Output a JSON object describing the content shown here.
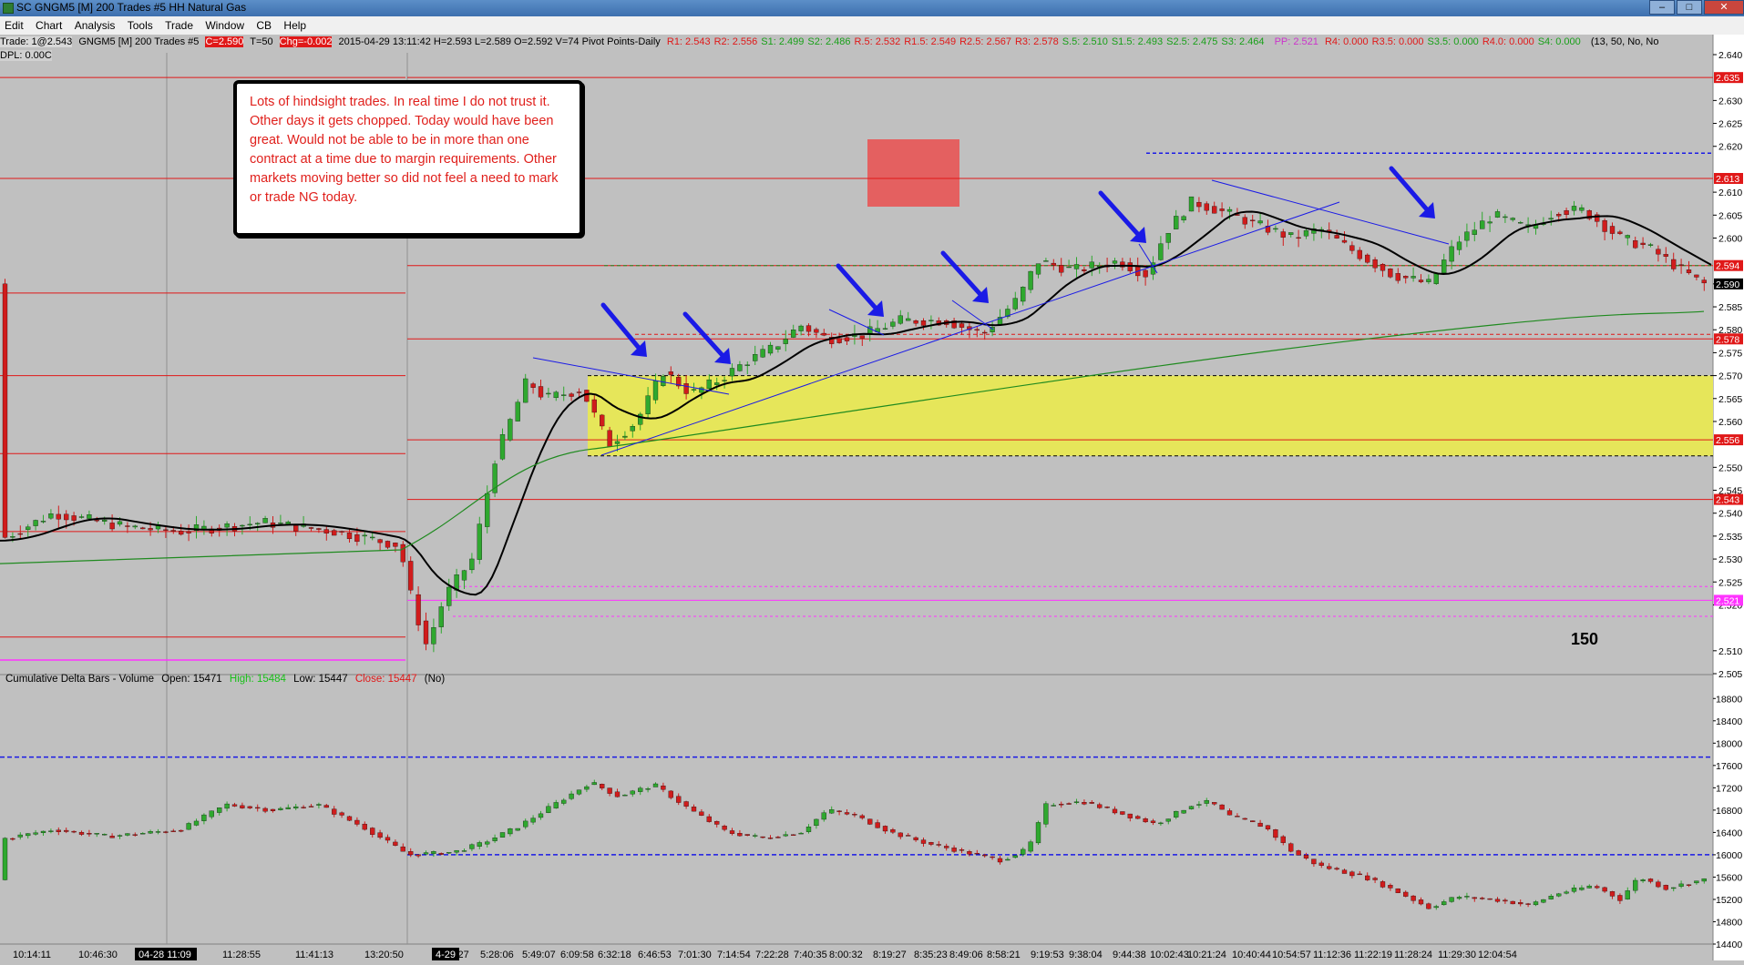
{
  "window": {
    "title": "SC GNGM5 [M]  200 Trades  #5  HH Natural Gas",
    "buttons": {
      "minimize": "–",
      "maximize": "□",
      "close": "✕"
    }
  },
  "menu": [
    "Edit",
    "Chart",
    "Analysis",
    "Tools",
    "Trade",
    "Window",
    "CB",
    "Help"
  ],
  "info": {
    "trade": "Trade: 1@2.543",
    "symbol": "GNGM5 [M]  200 Trades #5",
    "last": "C=2.590",
    "tq": "T=50",
    "chg": "Chg=-0.002",
    "ohlc": "2015-04-29 13:11:42 H=2.593 L=2.589 O=2.592 V=74 Pivot Points-Daily",
    "levels": [
      "R1: 2.543",
      "R2: 2.556",
      "S1: 2.499",
      "S2: 2.486",
      "R.5: 2.532",
      "R1.5: 2.549",
      "R2.5: 2.567",
      "R3: 2.578",
      "S.5: 2.510",
      "S1.5: 2.493",
      "S2.5: 2.475",
      "S3: 2.464"
    ],
    "pp": "PP: 2.521",
    "extra": [
      "R4: 0.000",
      "R3.5: 0.000",
      "S3.5: 0.000",
      "R4.0: 0.000",
      "S4: 0.000"
    ],
    "params": "(13, 50, No, No"
  },
  "dpl": "DPL: 0.00C",
  "note": "Lots of hindsight trades.  In real time I do not trust it.  Other days it gets chopped.  Today would have been great.  Would not be able to be in more than one contract at a time due to margin requirements.  Other markets moving better so did not feel a need to mark or trade NG today.",
  "big_label": "150",
  "lower_header": {
    "name": "Cumulative Delta Bars - Volume",
    "open": "Open: 15471",
    "high": "High: 15484",
    "low": "Low: 15447",
    "close": "Close: 15447",
    "flag": "(No)"
  },
  "colors": {
    "background": "#c0c0c0",
    "up_candle": "#2fa82f",
    "down_candle": "#d01c1c",
    "pivot_line": "#e01818",
    "arrow": "#1a1ae6",
    "zone": "#e6e65a",
    "box": "#e46060",
    "magenta": "#ff33ff"
  },
  "price_axis": {
    "min": 2.505,
    "max": 2.64,
    "ticks": [
      "2.640",
      "2.630",
      "2.625",
      "2.620",
      "2.610",
      "2.605",
      "2.600",
      "2.590",
      "2.585",
      "2.580",
      "2.575",
      "2.570",
      "2.565",
      "2.560",
      "2.550",
      "2.545",
      "2.540",
      "2.535",
      "2.530",
      "2.525",
      "2.520",
      "2.510",
      "2.505"
    ],
    "markers": [
      {
        "value": 2.635,
        "label": "2.635",
        "color": "#e01818"
      },
      {
        "value": 2.613,
        "label": "2.613",
        "color": "#e01818"
      },
      {
        "value": 2.594,
        "label": "2.594",
        "color": "#e01818"
      },
      {
        "value": 2.59,
        "label": "2.590",
        "color": "#000000"
      },
      {
        "value": 2.578,
        "label": "2.578",
        "color": "#e01818"
      },
      {
        "value": 2.556,
        "label": "2.556",
        "color": "#e01818"
      },
      {
        "value": 2.543,
        "label": "2.543",
        "color": "#e01818"
      },
      {
        "value": 2.521,
        "label": "2.521",
        "color": "#ff33ff"
      }
    ]
  },
  "delta_axis": {
    "min": 14400,
    "max": 19000,
    "ticks": [
      "18800",
      "18400",
      "18000",
      "17600",
      "17200",
      "16800",
      "16400",
      "16000",
      "15600",
      "15200",
      "14800",
      "14400"
    ]
  },
  "time_axis": [
    "10:14:11",
    "10:46:30",
    "11:09:40",
    "11:28:55",
    "11:41:13",
    "13:20:50",
    "5:02:27",
    "5:28:06",
    "5:49:07",
    "6:09:58",
    "6:32:18",
    "6:46:53",
    "7:01:30",
    "7:14:54",
    "7:22:28",
    "7:40:35",
    "8:00:32",
    "8:19:27",
    "8:35:23",
    "8:49:06",
    "8:58:21",
    "9:19:53",
    "9:38:04",
    "9:44:38",
    "10:02:43",
    "10:21:24",
    "10:40:44",
    "10:54:57",
    "11:12:36",
    "11:22:19",
    "11:28:24",
    "11:29:30",
    "12:04:54"
  ],
  "time_markers": [
    "04-28 11:09",
    "4-29"
  ],
  "chart_data": {
    "type": "candlestick",
    "upper_series_count": 150,
    "lower_series_count": 150
  }
}
